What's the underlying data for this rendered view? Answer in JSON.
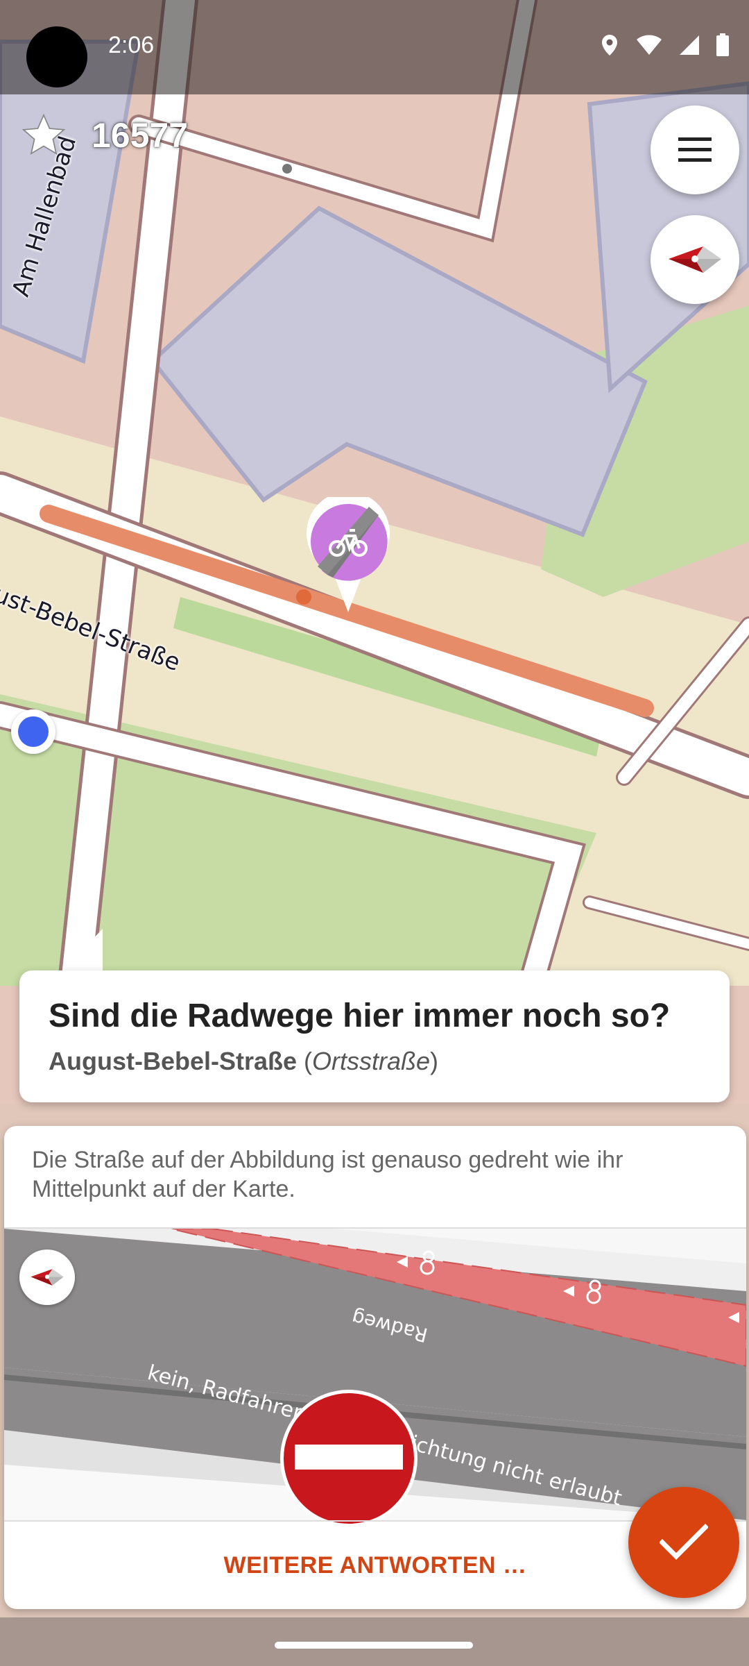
{
  "status_bar": {
    "time": "2:06"
  },
  "map": {
    "star_count": "16577",
    "street_label_1": "Am Hallenbad",
    "street_label_2": "ust-Bebel-Straße"
  },
  "quest": {
    "question": "Sind die Radwege hier immer noch so?",
    "street_name": "August-Bebel-Straße",
    "street_type_open": " (",
    "street_type": "Ortsstraße",
    "street_type_close": ")"
  },
  "answer_card": {
    "hint": "Die Straße auf der Abbildung ist genauso gedreht wie ihr Mittelpunkt auf der Karte.",
    "illustration_label_radweg": "Radweg",
    "illustration_label_no_entry": "kein, Radfahren in diese Richtung nicht erlaubt",
    "more_answers_label": "WEITERE ANTWORTEN …"
  },
  "colors": {
    "accent": "#d84310",
    "bike_lane": "#e06c6c",
    "road": "#8c8a8a",
    "no_entry": "#c8171d",
    "location": "#3e64f0"
  }
}
